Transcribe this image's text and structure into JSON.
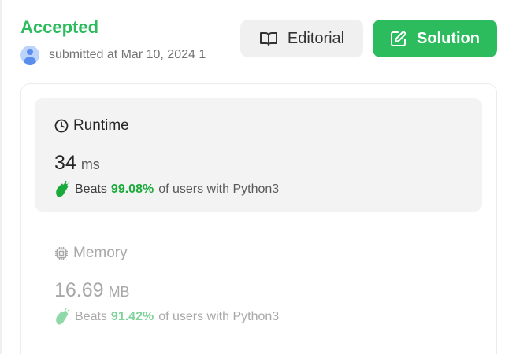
{
  "submission": {
    "status": "Accepted",
    "submitted_text": "submitted at Mar 10, 2024 1"
  },
  "buttons": {
    "editorial": "Editorial",
    "solution": "Solution"
  },
  "runtime": {
    "title": "Runtime",
    "value": "34",
    "unit": "ms",
    "beats_label": "Beats",
    "percent": "99.08%",
    "suffix": "of users with Python3"
  },
  "memory": {
    "title": "Memory",
    "value": "16.69",
    "unit": "MB",
    "beats_label": "Beats",
    "percent": "91.42%",
    "suffix": "of users with Python3"
  },
  "colors": {
    "accent_green": "#2cbb5d",
    "percent_green": "#1aaa3b"
  },
  "icons": [
    "user-avatar",
    "book-icon",
    "edit-icon",
    "clock-icon",
    "chip-icon",
    "clap-icon"
  ]
}
